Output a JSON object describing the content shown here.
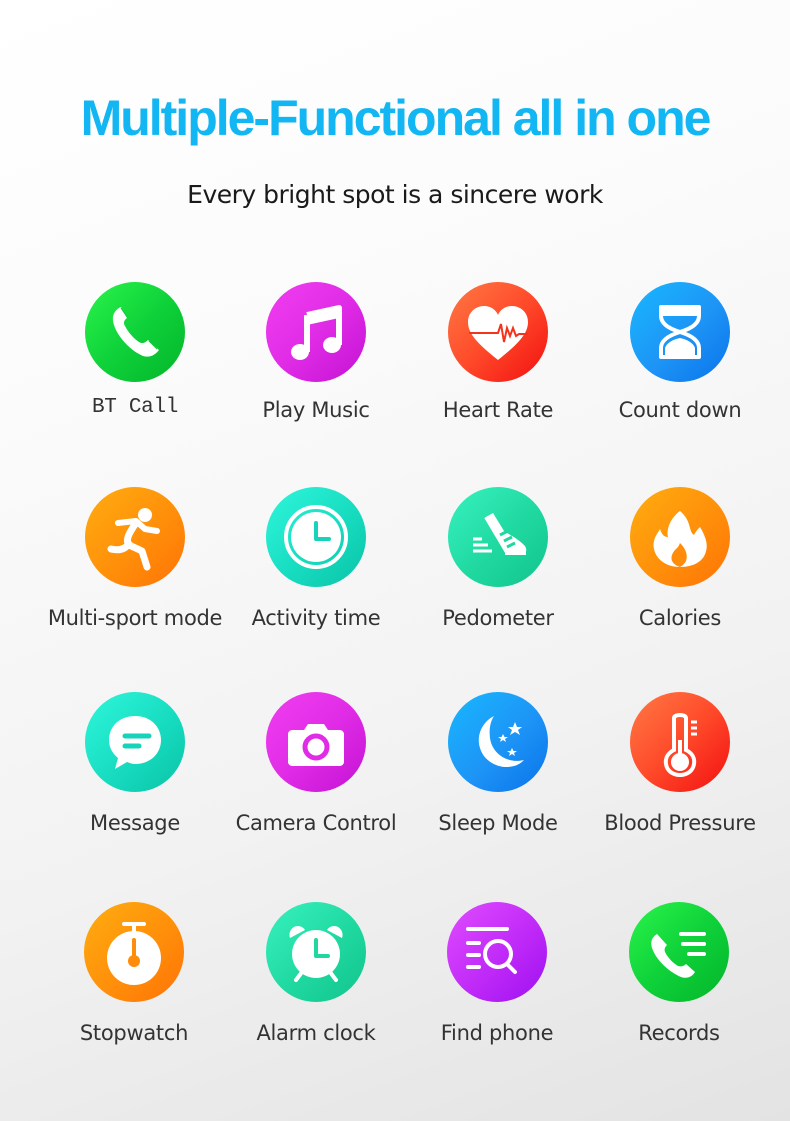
{
  "header": {
    "title": "Multiple-Functional all in one",
    "subtitle": "Every bright spot is a sincere work",
    "title_color": "#12b6f2"
  },
  "features": [
    {
      "label": "BT Call",
      "icon": "phone-icon",
      "color": "#0fd23a"
    },
    {
      "label": "Play Music",
      "icon": "music-note-icon",
      "color": "#e02ce6"
    },
    {
      "label": "Heart Rate",
      "icon": "heart-pulse-icon",
      "color": "#ff4a2a"
    },
    {
      "label": "Count down",
      "icon": "hourglass-icon",
      "color": "#1d94f6"
    },
    {
      "label": "Multi-sport mode",
      "icon": "running-person-icon",
      "color": "#ff8f0a"
    },
    {
      "label": "Activity time",
      "icon": "clock-icon",
      "color": "#17dcc0"
    },
    {
      "label": "Pedometer",
      "icon": "sneaker-icon",
      "color": "#1fd8a0"
    },
    {
      "label": "Calories",
      "icon": "flame-icon",
      "color": "#ff8f0a"
    },
    {
      "label": "Message",
      "icon": "chat-bubble-icon",
      "color": "#17dcc0"
    },
    {
      "label": "Camera Control",
      "icon": "camera-icon",
      "color": "#e02ce6"
    },
    {
      "label": "Sleep Mode",
      "icon": "moon-stars-icon",
      "color": "#1d94f6"
    },
    {
      "label": "Blood Pressure",
      "icon": "thermometer-icon",
      "color": "#ff4a2a"
    },
    {
      "label": "Stopwatch",
      "icon": "stopwatch-icon",
      "color": "#ff8f0a"
    },
    {
      "label": "Alarm clock",
      "icon": "alarm-clock-icon",
      "color": "#1fd8a0"
    },
    {
      "label": "Find phone",
      "icon": "search-list-icon",
      "color": "#c02af8"
    },
    {
      "label": "Records",
      "icon": "call-log-icon",
      "color": "#0fd23a"
    }
  ]
}
